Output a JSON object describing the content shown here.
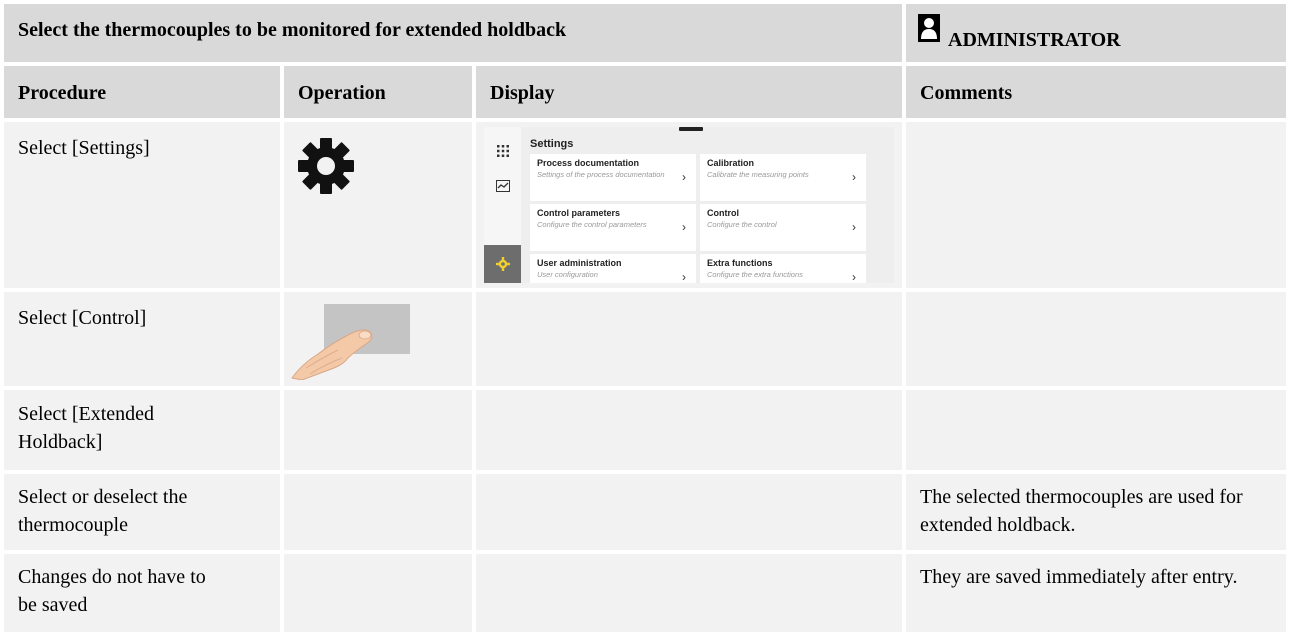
{
  "header": {
    "title": "Select the thermocouples to be monitored for extended holdback",
    "role": "ADMINISTRATOR"
  },
  "columns": {
    "procedure": "Procedure",
    "operation": "Operation",
    "display": "Display",
    "comments": "Comments"
  },
  "rows": [
    {
      "procedure": "Select [Settings]",
      "comment": ""
    },
    {
      "procedure": "Select [Control]",
      "comment": ""
    },
    {
      "procedure": "Select [Extended Holdback]",
      "comment": ""
    },
    {
      "procedure": "Select or deselect the thermocouple",
      "comment": "The selected thermocouples are used for extended holdback."
    },
    {
      "procedure": "Changes do not have to be saved",
      "comment": "They are saved immediately after entry."
    }
  ],
  "screenshot": {
    "title": "Settings",
    "tiles": [
      {
        "title": "Process documentation",
        "subtitle": "Settings of the process documentation"
      },
      {
        "title": "Calibration",
        "subtitle": "Calibrate the measuring points"
      },
      {
        "title": "Control parameters",
        "subtitle": "Configure the control parameters"
      },
      {
        "title": "Control",
        "subtitle": "Configure the control"
      },
      {
        "title": "User administration",
        "subtitle": "User configuration"
      },
      {
        "title": "Extra functions",
        "subtitle": "Configure the extra functions"
      }
    ],
    "sidebar_icons": [
      "apps-grid-icon",
      "chart-icon",
      "gear-icon"
    ],
    "accent_color": "#f2d12e"
  }
}
